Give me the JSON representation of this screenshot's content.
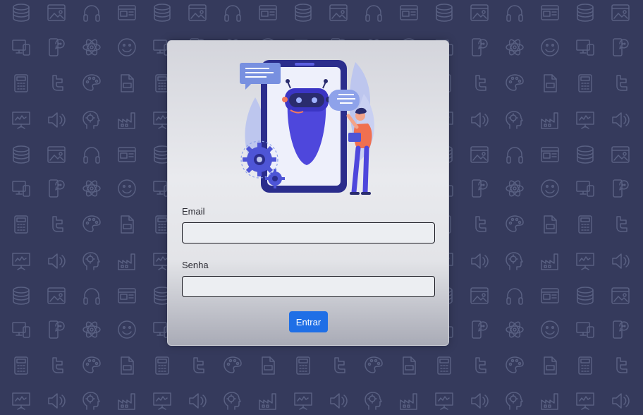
{
  "background": {
    "color": "#353a5c",
    "icon_color": "#596082",
    "icons": [
      "database-icon",
      "image-icon",
      "headphones-icon",
      "browser-window-icon",
      "devices-icon",
      "chat-phone-icon",
      "atom-icon",
      "smiley-icon",
      "calculator-icon",
      "twitter-icon",
      "palette-icon",
      "jpg-file-icon",
      "chart-presentation-icon",
      "speaker-icon",
      "brain-icon",
      "factory-icon"
    ]
  },
  "login_form": {
    "illustration": "chatbot-robot-illustration",
    "email_label": "Email",
    "email_value": "",
    "password_label": "Senha",
    "password_value": "",
    "submit_label": "Entrar",
    "accent_color": "#1f6fe6"
  }
}
